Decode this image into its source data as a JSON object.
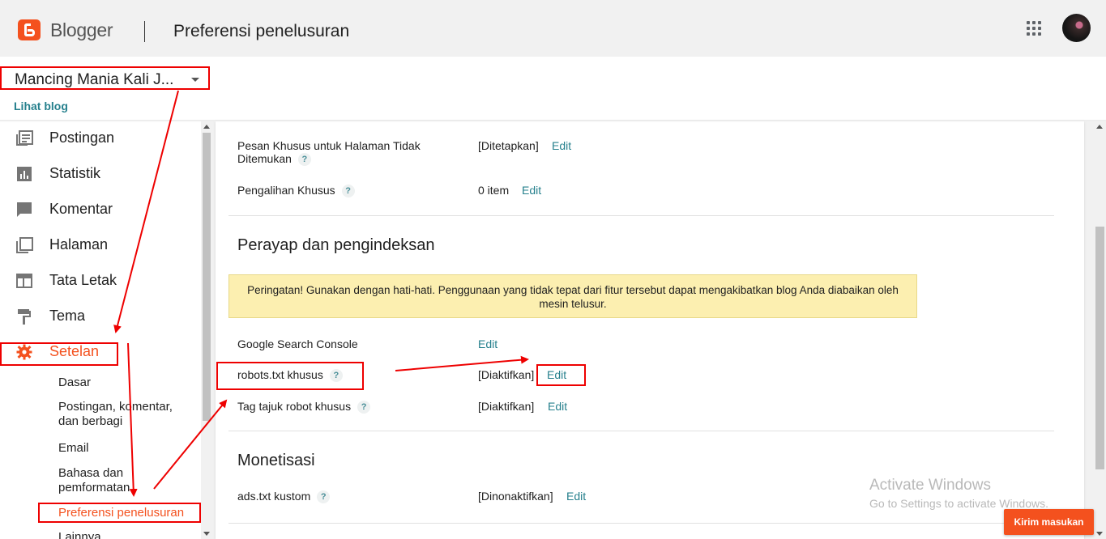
{
  "header": {
    "brand": "Blogger",
    "title": "Preferensi penelusuran"
  },
  "blog": {
    "name": "Mancing Mania Kali J...",
    "view_blog": "Lihat blog"
  },
  "sidebar": {
    "items": [
      {
        "label": "Postingan",
        "icon": "posts-icon"
      },
      {
        "label": "Statistik",
        "icon": "stats-icon"
      },
      {
        "label": "Komentar",
        "icon": "comment-icon"
      },
      {
        "label": "Halaman",
        "icon": "pages-icon"
      },
      {
        "label": "Tata Letak",
        "icon": "layout-icon"
      },
      {
        "label": "Tema",
        "icon": "theme-icon"
      },
      {
        "label": "Setelan",
        "icon": "gear-icon"
      }
    ],
    "sub_items": [
      "Dasar",
      "Postingan, komentar, dan berbagi",
      "Email",
      "Bahasa dan pemformatan",
      "Preferensi penelusuran",
      "Lainnya"
    ]
  },
  "content": {
    "error_page": {
      "label": "Pesan Khusus untuk Halaman Tidak Ditemukan",
      "value": "[Ditetapkan]",
      "edit": "Edit"
    },
    "redirects": {
      "label": "Pengalihan Khusus",
      "value": "0 item",
      "edit": "Edit"
    },
    "crawl_section": "Perayap dan pengindeksan",
    "warning": "Peringatan! Gunakan dengan hati-hati. Penggunaan yang tidak tepat dari fitur tersebut dapat mengakibatkan blog Anda diabaikan oleh mesin telusur.",
    "search_console": {
      "label": "Google Search Console",
      "edit": "Edit"
    },
    "robots_txt": {
      "label": "robots.txt khusus",
      "value": "[Diaktifkan]",
      "edit": "Edit"
    },
    "robot_tags": {
      "label": "Tag tajuk robot khusus",
      "value": "[Diaktifkan]",
      "edit": "Edit"
    },
    "monetization_section": "Monetisasi",
    "ads_txt": {
      "label": "ads.txt kustom",
      "value": "[Dinonaktifkan]",
      "edit": "Edit"
    },
    "help": "?"
  },
  "watermark": {
    "line1": "Activate Windows",
    "line2": "Go to Settings to activate Windows."
  },
  "feedback_button": "Kirim masukan",
  "colors": {
    "accent": "#f4511e",
    "link": "#26808d",
    "annotation": "#e00000",
    "warning_bg": "#fcefb0"
  }
}
